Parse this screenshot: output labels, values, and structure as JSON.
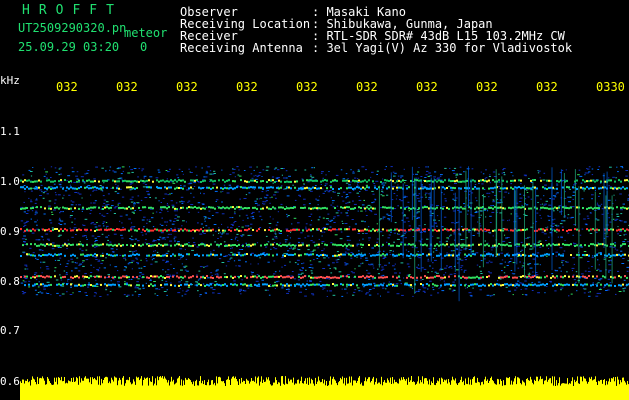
{
  "header": {
    "title": "HROFFT",
    "filename": "UT2509290320.pn",
    "datetime": "25.09.29 03:20",
    "counter": "0",
    "mode": "meteor",
    "labels": {
      "observer": "Observer",
      "location": "Receiving Location",
      "receiver": "Receiver",
      "antenna": "Receiving Antenna"
    },
    "values": {
      "observer": ": Masaki Kano",
      "location": ": Shibukawa, Gunma, Japan",
      "receiver": ": RTL-SDR SDR# 43dB L15 103.2MHz CW",
      "antenna": ": 3el Yagi(V) Az 330 for Vladivostok"
    }
  },
  "axis": {
    "unit": "kHz",
    "y_labels": [
      "1.1",
      "1.0",
      "0.9",
      "0.8",
      "0.7",
      "0.6"
    ],
    "time_labels": [
      "032",
      "032",
      "032",
      "032",
      "032",
      "032",
      "032",
      "032",
      "032",
      "0330"
    ]
  },
  "colors": {
    "header_green": "#20e070",
    "time_label_yellow": "#ffff00",
    "noise_yellow": "#ffff00"
  }
}
